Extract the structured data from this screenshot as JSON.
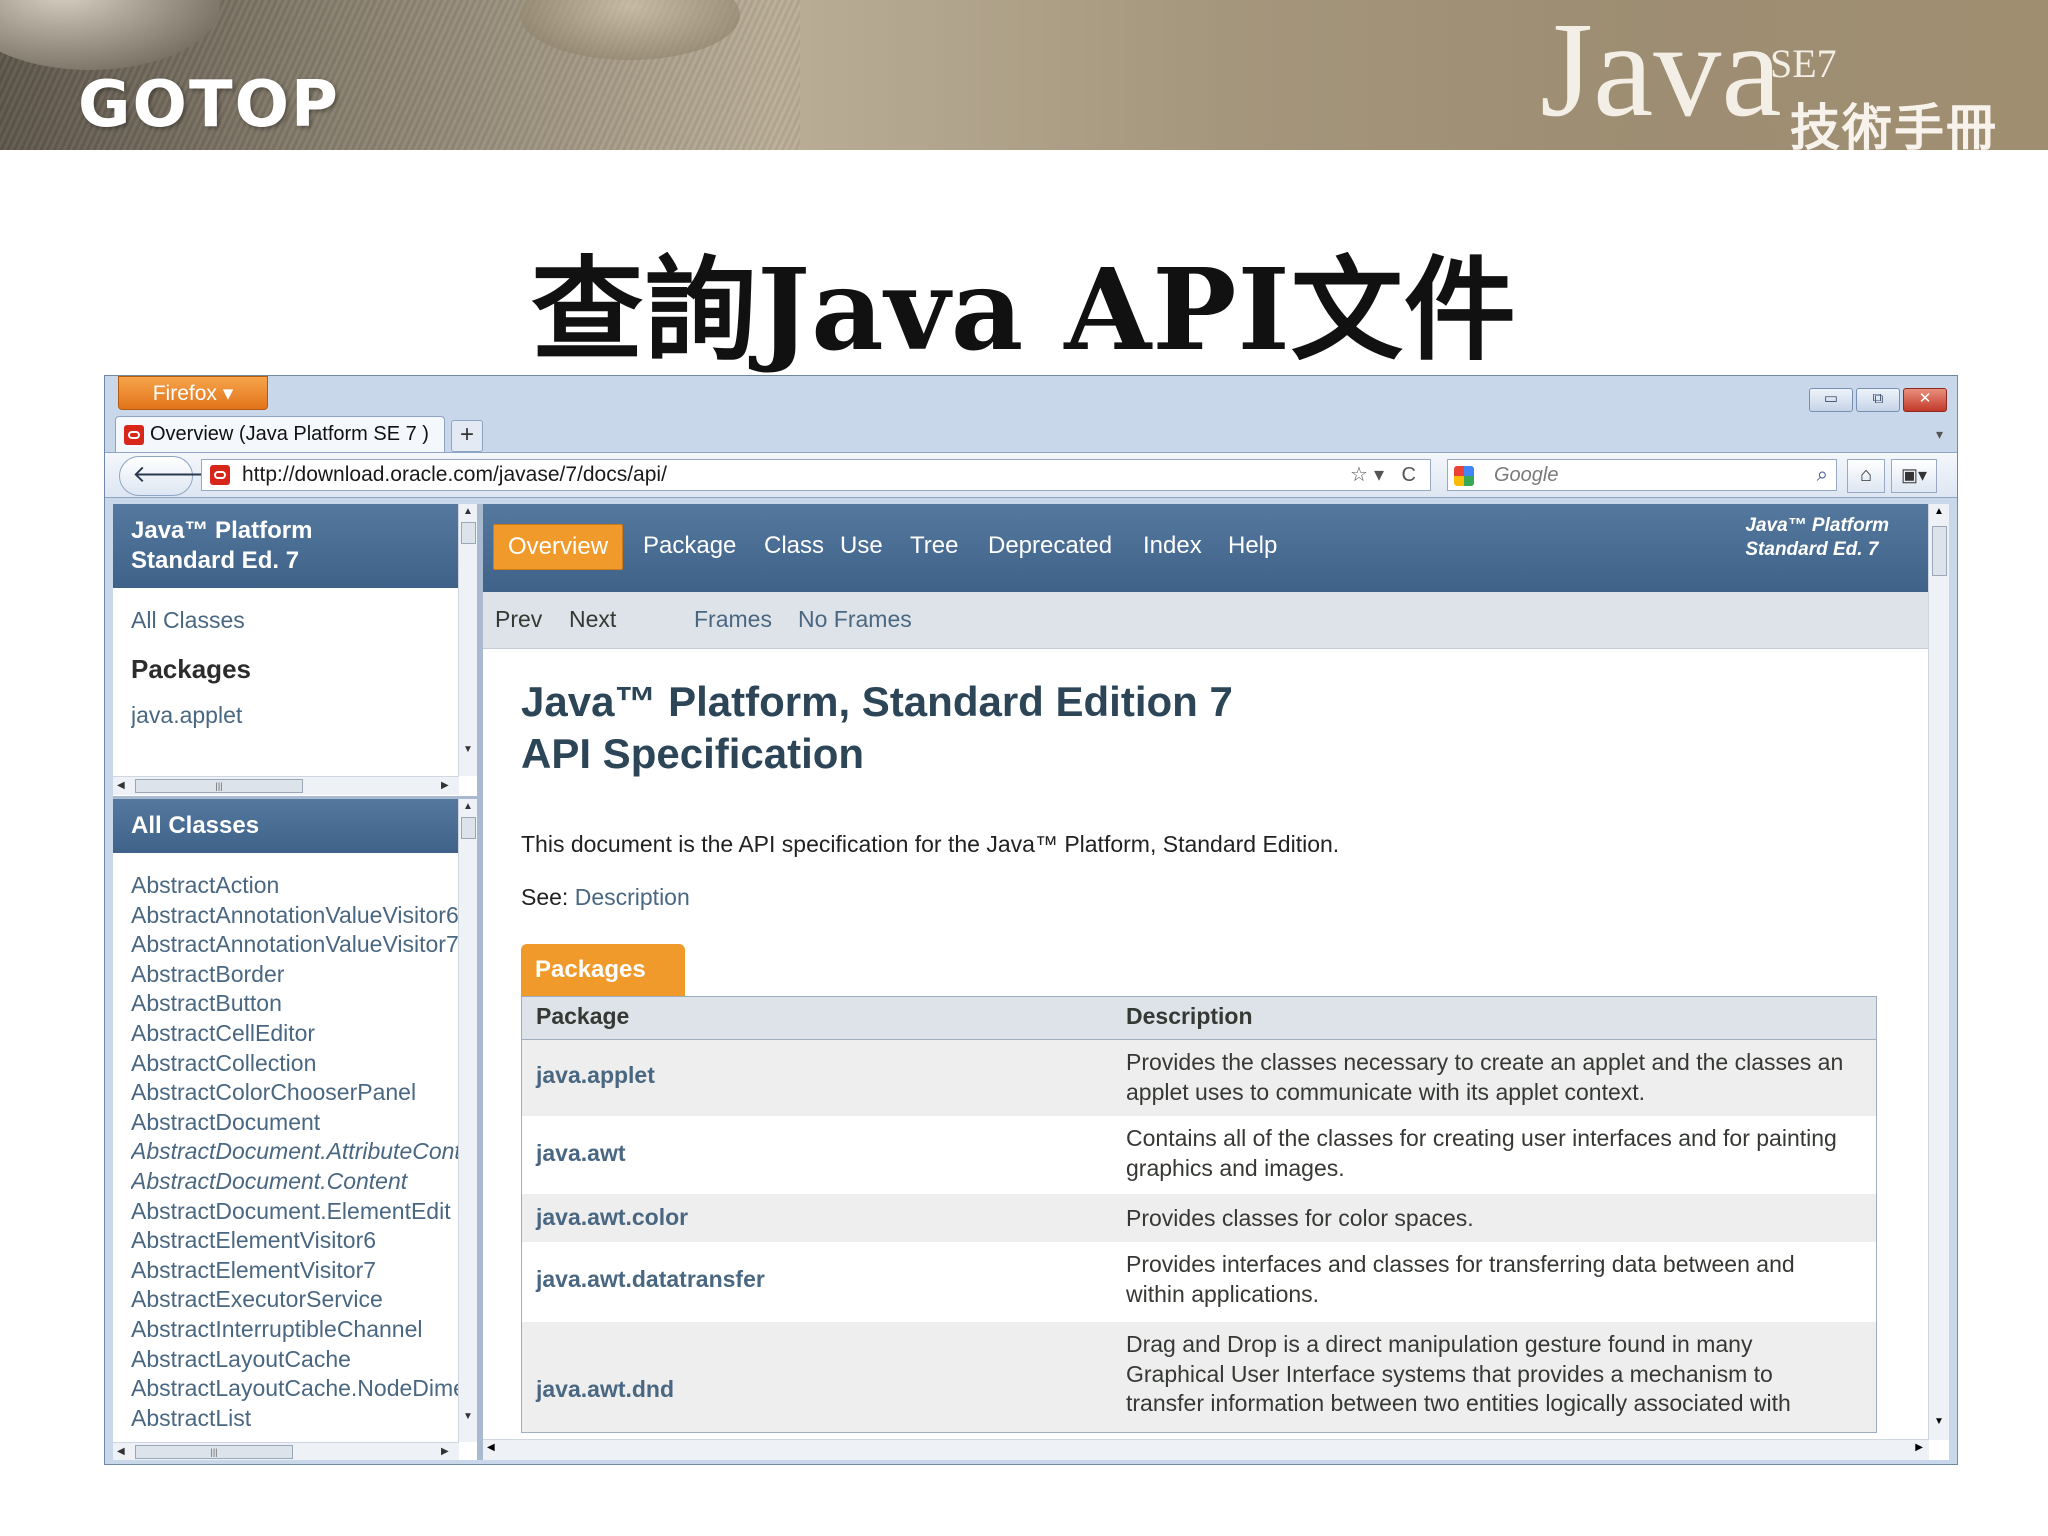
{
  "slide": {
    "brand": "GOTOP",
    "logo": {
      "java": "Java",
      "se7": "SE7",
      "book": "技術手冊"
    },
    "title": "查詢Java API文件"
  },
  "browser": {
    "menu_button": "Firefox ▾",
    "window_controls": {
      "minimize": "▭",
      "maximize": "⧉",
      "close": "✕"
    },
    "tab_title": "Overview (Java Platform SE 7 )",
    "new_tab": "+",
    "url": "http://download.oracle.com/javase/7/docs/api/",
    "url_tools": "☆▾ C",
    "search_placeholder": "Google",
    "search_icon": "magnifier-icon",
    "home_icon": "home-icon",
    "bookmarks_icon": "bookmarks-icon"
  },
  "left_top": {
    "header": "Java™ Platform\nStandard Ed. 7",
    "all_classes_link": "All Classes",
    "packages_heading": "Packages",
    "packages": [
      "java.applet"
    ]
  },
  "left_bottom": {
    "header": "All Classes",
    "classes": [
      {
        "name": "AbstractAction",
        "italic": false
      },
      {
        "name": "AbstractAnnotationValueVisitor6",
        "italic": false
      },
      {
        "name": "AbstractAnnotationValueVisitor7",
        "italic": false
      },
      {
        "name": "AbstractBorder",
        "italic": false
      },
      {
        "name": "AbstractButton",
        "italic": false
      },
      {
        "name": "AbstractCellEditor",
        "italic": false
      },
      {
        "name": "AbstractCollection",
        "italic": false
      },
      {
        "name": "AbstractColorChooserPanel",
        "italic": false
      },
      {
        "name": "AbstractDocument",
        "italic": false
      },
      {
        "name": "AbstractDocument.AttributeContext",
        "italic": true
      },
      {
        "name": "AbstractDocument.Content",
        "italic": true
      },
      {
        "name": "AbstractDocument.ElementEdit",
        "italic": false
      },
      {
        "name": "AbstractElementVisitor6",
        "italic": false
      },
      {
        "name": "AbstractElementVisitor7",
        "italic": false
      },
      {
        "name": "AbstractExecutorService",
        "italic": false
      },
      {
        "name": "AbstractInterruptibleChannel",
        "italic": false
      },
      {
        "name": "AbstractLayoutCache",
        "italic": false
      },
      {
        "name": "AbstractLayoutCache.NodeDimensions",
        "italic": false
      },
      {
        "name": "AbstractList",
        "italic": false
      }
    ]
  },
  "main": {
    "nav": [
      "Overview",
      "Package",
      "Class",
      "Use",
      "Tree",
      "Deprecated",
      "Index",
      "Help"
    ],
    "about": "Java™ Platform\nStandard Ed. 7",
    "subnav": {
      "prev": "Prev",
      "next": "Next",
      "frames": "Frames",
      "no_frames": "No Frames"
    },
    "title_line1": "Java™ Platform, Standard Edition 7",
    "title_line2": "API Specification",
    "intro": "This document is the API specification for the Java™ Platform, Standard Edition.",
    "see_label": "See: ",
    "see_link": "Description",
    "packages_tab": "Packages",
    "table": {
      "headers": [
        "Package",
        "Description"
      ],
      "rows": [
        {
          "package": "java.applet",
          "description": "Provides the classes necessary to create an applet and the classes an applet uses to communicate with its applet context."
        },
        {
          "package": "java.awt",
          "description": "Contains all of the classes for creating user interfaces and for painting graphics and images."
        },
        {
          "package": "java.awt.color",
          "description": "Provides classes for color spaces."
        },
        {
          "package": "java.awt.datatransfer",
          "description": "Provides interfaces and classes for transferring data between and within applications."
        },
        {
          "package": "java.awt.dnd",
          "description": "Drag and Drop is a direct manipulation gesture found in many Graphical User Interface systems that provides a mechanism to transfer information between two entities logically associated with"
        }
      ]
    }
  }
}
